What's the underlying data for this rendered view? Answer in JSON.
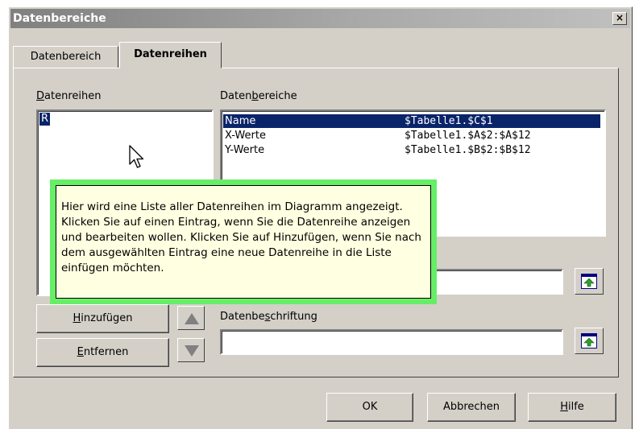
{
  "window": {
    "title": "Datenbereiche",
    "close_glyph": "×"
  },
  "tabs": [
    {
      "label": "Datenbereich"
    },
    {
      "label": "Datenreihen"
    }
  ],
  "series_panel": {
    "label": "Datenreihen",
    "label_underline_char": "D",
    "items": [
      {
        "name": "R"
      }
    ]
  },
  "ranges_panel": {
    "label_pre": "Daten",
    "label_underline": "b",
    "label_post": "ereiche",
    "rows": [
      {
        "name": "Name",
        "value": "$Tabelle1.$C$1"
      },
      {
        "name": "X-Werte",
        "value": "$Tabelle1.$A$2:$A$12"
      },
      {
        "name": "Y-Werte",
        "value": "$Tabelle1.$B$2:$B$12"
      }
    ]
  },
  "range_field": {
    "value": ""
  },
  "label_field": {
    "label_pre": "Datenbe",
    "label_underline": "s",
    "label_post": "chriftung",
    "value": ""
  },
  "buttons": {
    "add": {
      "underline": "H",
      "rest": "inzufügen"
    },
    "remove": {
      "underline": "E",
      "rest": "ntfernen"
    },
    "ok": "OK",
    "cancel": "Abbrechen",
    "help": {
      "underline": "H",
      "rest": "ilfe"
    }
  },
  "tooltip": {
    "text": "Hier wird eine Liste aller Datenreihen im Diagramm angezeigt. Klicken Sie auf einen Eintrag, wenn Sie die Datenreihe anzeigen und bearbeiten wollen. Klicken Sie auf Hinzufügen, wenn Sie nach dem ausgewählten Eintrag eine neue Datenreihe in die Liste einfügen möchten."
  },
  "colors": {
    "dialog_bg": "#d4d0c8",
    "selection": "#0a246a",
    "tooltip_bg": "#ffffe1",
    "highlight_border": "#66ee66"
  },
  "icons": {
    "close": "close-icon",
    "move_up": "arrow-up-icon",
    "move_down": "arrow-down-icon",
    "select_range": "range-select-icon",
    "cursor": "mouse-pointer-icon"
  }
}
